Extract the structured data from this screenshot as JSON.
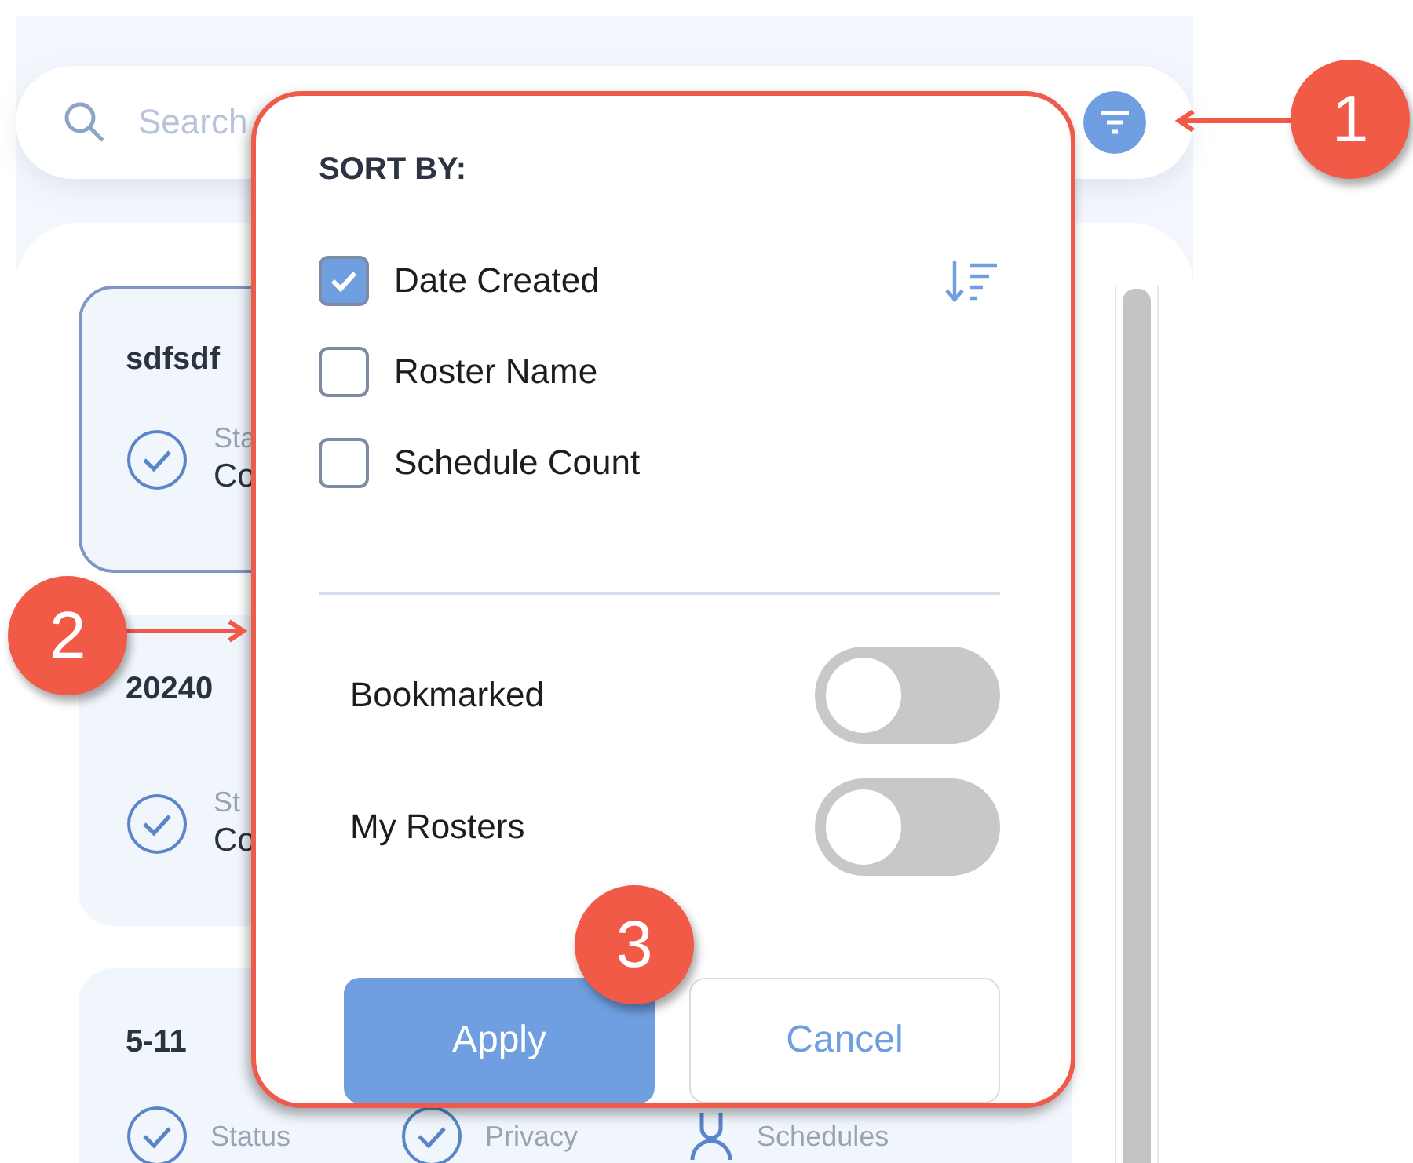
{
  "search": {
    "placeholder": "Search"
  },
  "cards": [
    {
      "kind": "status",
      "title": "sdfsdf",
      "selected": true,
      "status_label": "Sta",
      "status_value": "Co"
    },
    {
      "kind": "status",
      "title": "20240",
      "selected": false,
      "status_label": "St",
      "status_value": "Co"
    },
    {
      "kind": "stats",
      "title": "5-11",
      "selected": false,
      "stats": [
        {
          "kind": "check",
          "label": "Status"
        },
        {
          "kind": "check",
          "label": "Privacy"
        },
        {
          "kind": "count",
          "label": "Schedules"
        }
      ]
    }
  ],
  "popup": {
    "title": "SORT BY:",
    "sort_options": [
      {
        "label": "Date Created",
        "checked": true
      },
      {
        "label": "Roster Name",
        "checked": false
      },
      {
        "label": "Schedule Count",
        "checked": false
      }
    ],
    "toggles": [
      {
        "label": "Bookmarked",
        "on": false
      },
      {
        "label": "My Rosters",
        "on": false
      }
    ],
    "buttons": [
      {
        "label": "Apply",
        "kind": "primary"
      },
      {
        "label": "Cancel",
        "kind": "secondary"
      }
    ]
  },
  "callouts": [
    {
      "label": "1"
    },
    {
      "label": "2"
    },
    {
      "label": "3"
    }
  ]
}
